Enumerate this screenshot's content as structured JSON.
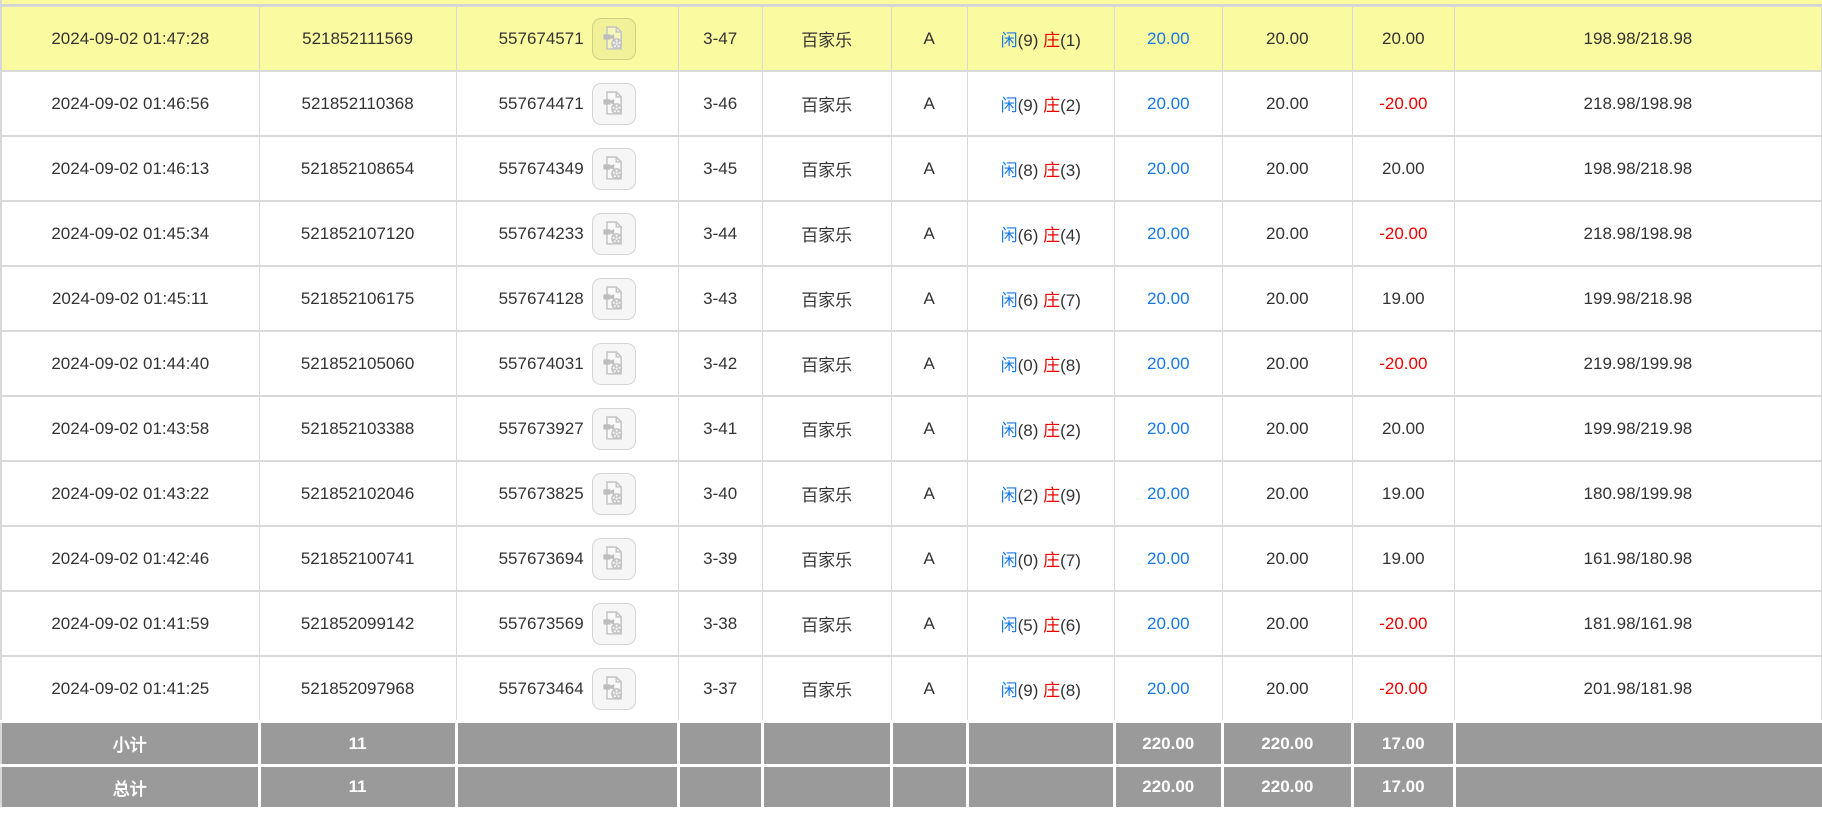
{
  "table": {
    "labels": {
      "player": "闲",
      "banker": "庄"
    },
    "colors": {
      "highlight": "#fafaa0",
      "link_blue": "#1777e8",
      "loss_red": "#ee0000",
      "footer_gray": "#9a9a9a",
      "text": "#333333",
      "border": "#d9d9d9"
    },
    "icon": "video-replay-icon",
    "rows": [
      {
        "time": "2024-09-02 01:47:28",
        "bet_id": "521852111569",
        "round_id": "557674571",
        "round_no": "3-47",
        "game": "百家乐",
        "table": "A",
        "player_score": "(9)",
        "banker_score": "(1)",
        "bet": "20.00",
        "valid": "20.00",
        "winloss": "20.00",
        "balance": "198.98/218.98",
        "highlighted": true
      },
      {
        "time": "2024-09-02 01:46:56",
        "bet_id": "521852110368",
        "round_id": "557674471",
        "round_no": "3-46",
        "game": "百家乐",
        "table": "A",
        "player_score": "(9)",
        "banker_score": "(2)",
        "bet": "20.00",
        "valid": "20.00",
        "winloss": "-20.00",
        "balance": "218.98/198.98",
        "highlighted": false
      },
      {
        "time": "2024-09-02 01:46:13",
        "bet_id": "521852108654",
        "round_id": "557674349",
        "round_no": "3-45",
        "game": "百家乐",
        "table": "A",
        "player_score": "(8)",
        "banker_score": "(3)",
        "bet": "20.00",
        "valid": "20.00",
        "winloss": "20.00",
        "balance": "198.98/218.98",
        "highlighted": false
      },
      {
        "time": "2024-09-02 01:45:34",
        "bet_id": "521852107120",
        "round_id": "557674233",
        "round_no": "3-44",
        "game": "百家乐",
        "table": "A",
        "player_score": "(6)",
        "banker_score": "(4)",
        "bet": "20.00",
        "valid": "20.00",
        "winloss": "-20.00",
        "balance": "218.98/198.98",
        "highlighted": false
      },
      {
        "time": "2024-09-02 01:45:11",
        "bet_id": "521852106175",
        "round_id": "557674128",
        "round_no": "3-43",
        "game": "百家乐",
        "table": "A",
        "player_score": "(6)",
        "banker_score": "(7)",
        "bet": "20.00",
        "valid": "20.00",
        "winloss": "19.00",
        "balance": "199.98/218.98",
        "highlighted": false
      },
      {
        "time": "2024-09-02 01:44:40",
        "bet_id": "521852105060",
        "round_id": "557674031",
        "round_no": "3-42",
        "game": "百家乐",
        "table": "A",
        "player_score": "(0)",
        "banker_score": "(8)",
        "bet": "20.00",
        "valid": "20.00",
        "winloss": "-20.00",
        "balance": "219.98/199.98",
        "highlighted": false
      },
      {
        "time": "2024-09-02 01:43:58",
        "bet_id": "521852103388",
        "round_id": "557673927",
        "round_no": "3-41",
        "game": "百家乐",
        "table": "A",
        "player_score": "(8)",
        "banker_score": "(2)",
        "bet": "20.00",
        "valid": "20.00",
        "winloss": "20.00",
        "balance": "199.98/219.98",
        "highlighted": false
      },
      {
        "time": "2024-09-02 01:43:22",
        "bet_id": "521852102046",
        "round_id": "557673825",
        "round_no": "3-40",
        "game": "百家乐",
        "table": "A",
        "player_score": "(2)",
        "banker_score": "(9)",
        "bet": "20.00",
        "valid": "20.00",
        "winloss": "19.00",
        "balance": "180.98/199.98",
        "highlighted": false
      },
      {
        "time": "2024-09-02 01:42:46",
        "bet_id": "521852100741",
        "round_id": "557673694",
        "round_no": "3-39",
        "game": "百家乐",
        "table": "A",
        "player_score": "(0)",
        "banker_score": "(7)",
        "bet": "20.00",
        "valid": "20.00",
        "winloss": "19.00",
        "balance": "161.98/180.98",
        "highlighted": false
      },
      {
        "time": "2024-09-02 01:41:59",
        "bet_id": "521852099142",
        "round_id": "557673569",
        "round_no": "3-38",
        "game": "百家乐",
        "table": "A",
        "player_score": "(5)",
        "banker_score": "(6)",
        "bet": "20.00",
        "valid": "20.00",
        "winloss": "-20.00",
        "balance": "181.98/161.98",
        "highlighted": false
      },
      {
        "time": "2024-09-02 01:41:25",
        "bet_id": "521852097968",
        "round_id": "557673464",
        "round_no": "3-37",
        "game": "百家乐",
        "table": "A",
        "player_score": "(9)",
        "banker_score": "(8)",
        "bet": "20.00",
        "valid": "20.00",
        "winloss": "-20.00",
        "balance": "201.98/181.98",
        "highlighted": false
      }
    ],
    "footer": [
      {
        "label": "小计",
        "count": "11",
        "bet": "220.00",
        "valid": "220.00",
        "winloss": "17.00"
      },
      {
        "label": "总计",
        "count": "11",
        "bet": "220.00",
        "valid": "220.00",
        "winloss": "17.00"
      }
    ]
  }
}
